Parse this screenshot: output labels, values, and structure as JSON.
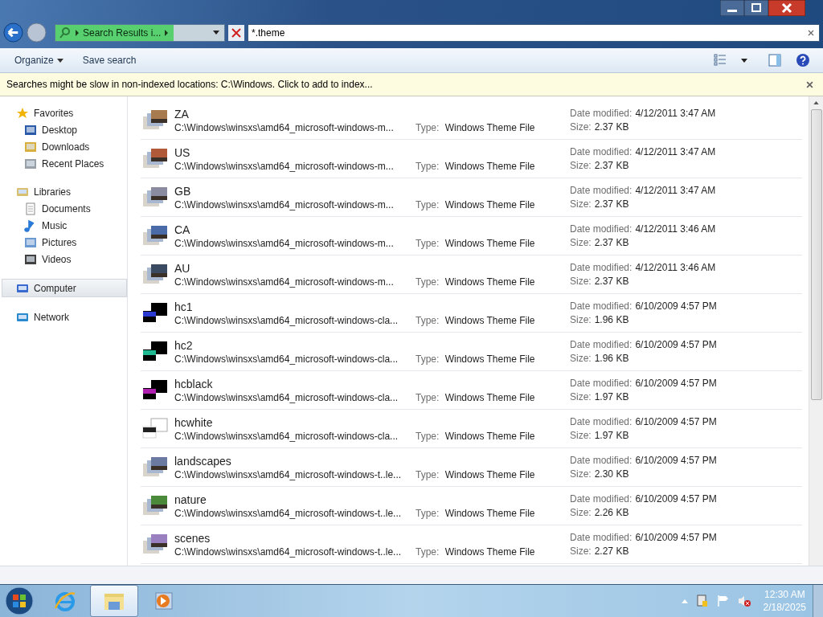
{
  "address_bar": {
    "crumb": "Search Results i..."
  },
  "search": {
    "value": "*.theme"
  },
  "toolbar": {
    "buttons": [
      "Organize",
      "Save search"
    ]
  },
  "info_bar": {
    "text": "Searches might be slow in non-indexed locations: C:\\Windows. Click to add to index..."
  },
  "sidebar": {
    "groups": [
      {
        "label": "Favorites",
        "selected": false,
        "children": [
          {
            "label": "Desktop",
            "selected": false
          },
          {
            "label": "Downloads",
            "selected": false
          },
          {
            "label": "Recent Places",
            "selected": false
          }
        ]
      },
      {
        "label": "Libraries",
        "selected": false,
        "children": [
          {
            "label": "Documents",
            "selected": false
          },
          {
            "label": "Music",
            "selected": false
          },
          {
            "label": "Pictures",
            "selected": false
          },
          {
            "label": "Videos",
            "selected": false
          }
        ]
      },
      {
        "label": "Computer",
        "selected": true
      },
      {
        "label": "Network",
        "selected": false
      }
    ]
  },
  "results": [
    {
      "name": "ZA",
      "path": "C:\\Windows\\winsxs\\amd64_microsoft-windows-m...",
      "type_label": "Type:",
      "type": "Windows Theme File",
      "date_label": "Date modified:",
      "date": "4/12/2011 3:47 AM",
      "size_label": "Size:",
      "size": "2.37 KB",
      "kind": "scenic",
      "color": "#a87a50"
    },
    {
      "name": "US",
      "path": "C:\\Windows\\winsxs\\amd64_microsoft-windows-m...",
      "type_label": "Type:",
      "type": "Windows Theme File",
      "date_label": "Date modified:",
      "date": "4/12/2011 3:47 AM",
      "size_label": "Size:",
      "size": "2.37 KB",
      "kind": "scenic",
      "color": "#b05a3a"
    },
    {
      "name": "GB",
      "path": "C:\\Windows\\winsxs\\amd64_microsoft-windows-m...",
      "type_label": "Type:",
      "type": "Windows Theme File",
      "date_label": "Date modified:",
      "date": "4/12/2011 3:47 AM",
      "size_label": "Size:",
      "size": "2.37 KB",
      "kind": "scenic",
      "color": "#8a8aa0"
    },
    {
      "name": "CA",
      "path": "C:\\Windows\\winsxs\\amd64_microsoft-windows-m...",
      "type_label": "Type:",
      "type": "Windows Theme File",
      "date_label": "Date modified:",
      "date": "4/12/2011 3:46 AM",
      "size_label": "Size:",
      "size": "2.37 KB",
      "kind": "scenic",
      "color": "#4a6aa8"
    },
    {
      "name": "AU",
      "path": "C:\\Windows\\winsxs\\amd64_microsoft-windows-m...",
      "type_label": "Type:",
      "type": "Windows Theme File",
      "date_label": "Date modified:",
      "date": "4/12/2011 3:46 AM",
      "size_label": "Size:",
      "size": "2.37 KB",
      "kind": "scenic",
      "color": "#3a4a60"
    },
    {
      "name": "hc1",
      "path": "C:\\Windows\\winsxs\\amd64_microsoft-windows-cla...",
      "type_label": "Type:",
      "type": "Windows Theme File",
      "date_label": "Date modified:",
      "date": "6/10/2009 4:57 PM",
      "size_label": "Size:",
      "size": "1.96 KB",
      "kind": "contrast",
      "color": "#2a3ad0"
    },
    {
      "name": "hc2",
      "path": "C:\\Windows\\winsxs\\amd64_microsoft-windows-cla...",
      "type_label": "Type:",
      "type": "Windows Theme File",
      "date_label": "Date modified:",
      "date": "6/10/2009 4:57 PM",
      "size_label": "Size:",
      "size": "1.96 KB",
      "kind": "contrast",
      "color": "#20b890"
    },
    {
      "name": "hcblack",
      "path": "C:\\Windows\\winsxs\\amd64_microsoft-windows-cla...",
      "type_label": "Type:",
      "type": "Windows Theme File",
      "date_label": "Date modified:",
      "date": "6/10/2009 4:57 PM",
      "size_label": "Size:",
      "size": "1.97 KB",
      "kind": "contrast",
      "color": "#b020b0"
    },
    {
      "name": "hcwhite",
      "path": "C:\\Windows\\winsxs\\amd64_microsoft-windows-cla...",
      "type_label": "Type:",
      "type": "Windows Theme File",
      "date_label": "Date modified:",
      "date": "6/10/2009 4:57 PM",
      "size_label": "Size:",
      "size": "1.97 KB",
      "kind": "light",
      "color": "#202020"
    },
    {
      "name": "landscapes",
      "path": "C:\\Windows\\winsxs\\amd64_microsoft-windows-t..le...",
      "type_label": "Type:",
      "type": "Windows Theme File",
      "date_label": "Date modified:",
      "date": "6/10/2009 4:57 PM",
      "size_label": "Size:",
      "size": "2.30 KB",
      "kind": "scenic",
      "color": "#6a7aa0"
    },
    {
      "name": "nature",
      "path": "C:\\Windows\\winsxs\\amd64_microsoft-windows-t..le...",
      "type_label": "Type:",
      "type": "Windows Theme File",
      "date_label": "Date modified:",
      "date": "6/10/2009 4:57 PM",
      "size_label": "Size:",
      "size": "2.26 KB",
      "kind": "scenic",
      "color": "#4a8a3a"
    },
    {
      "name": "scenes",
      "path": "C:\\Windows\\winsxs\\amd64_microsoft-windows-t..le...",
      "type_label": "Type:",
      "type": "Windows Theme File",
      "date_label": "Date modified:",
      "date": "6/10/2009 4:57 PM",
      "size_label": "Size:",
      "size": "2.27 KB",
      "kind": "scenic",
      "color": "#9a80c0"
    }
  ],
  "taskbar": {
    "apps": [
      {
        "kind": "browser",
        "selected": false
      },
      {
        "kind": "explorer",
        "selected": true
      },
      {
        "kind": "media",
        "selected": false
      }
    ],
    "time": "12:30 AM",
    "date": "2/18/2025"
  }
}
